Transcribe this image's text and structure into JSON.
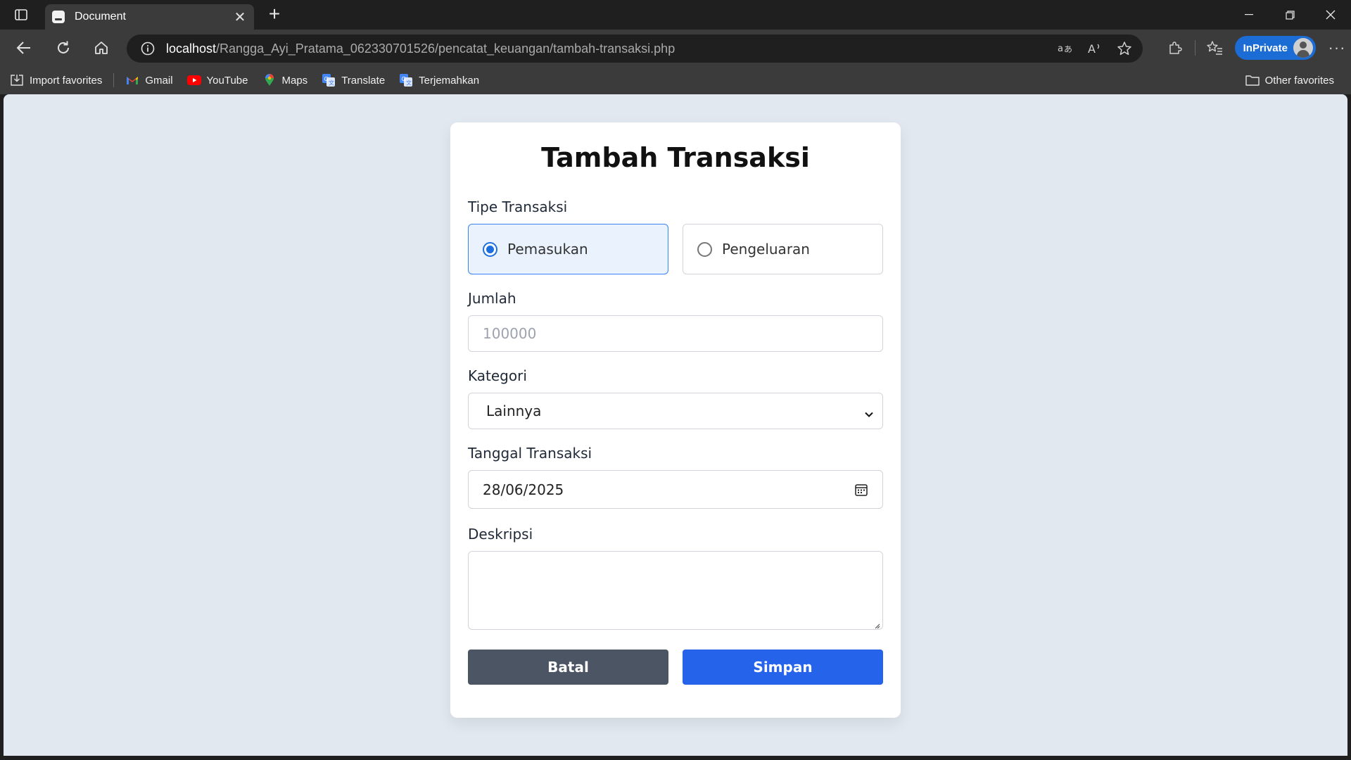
{
  "browser": {
    "tab_title": "Document",
    "tab_close": "✕",
    "new_tab": "+",
    "url_host": "localhost",
    "url_path": "/Rangga_Ayi_Pratama_062330701526/pencatat_keuangan/tambah-transaksi.php",
    "inprivate_label": "InPrivate",
    "more": "···",
    "favorites": [
      {
        "label": "Import favorites",
        "icon": "import-icon"
      },
      {
        "label": "Gmail",
        "icon": "gmail-icon"
      },
      {
        "label": "YouTube",
        "icon": "youtube-icon"
      },
      {
        "label": "Maps",
        "icon": "maps-icon"
      },
      {
        "label": "Translate",
        "icon": "translate-icon"
      },
      {
        "label": "Terjemahkan",
        "icon": "translate-icon"
      }
    ],
    "other_favorites": "Other favorites"
  },
  "form": {
    "title": "Tambah Transaksi",
    "tipe_label": "Tipe Transaksi",
    "tipe_options": [
      {
        "label": "Pemasukan",
        "checked": true
      },
      {
        "label": "Pengeluaran",
        "checked": false
      }
    ],
    "jumlah_label": "Jumlah",
    "jumlah_placeholder": "100000",
    "kategori_label": "Kategori",
    "kategori_value": "Lainnya",
    "tanggal_label": "Tanggal Transaksi",
    "tanggal_value": "28/06/2025",
    "deskripsi_label": "Deskripsi",
    "deskripsi_value": "",
    "batal_label": "Batal",
    "simpan_label": "Simpan"
  },
  "colors": {
    "page_bg": "#e2e8f0",
    "batal_bg": "#4b5563",
    "simpan_bg": "#2563eb",
    "inprivate_bg": "#1c6cd6",
    "selected_radio_bg": "#eaf2fe"
  }
}
